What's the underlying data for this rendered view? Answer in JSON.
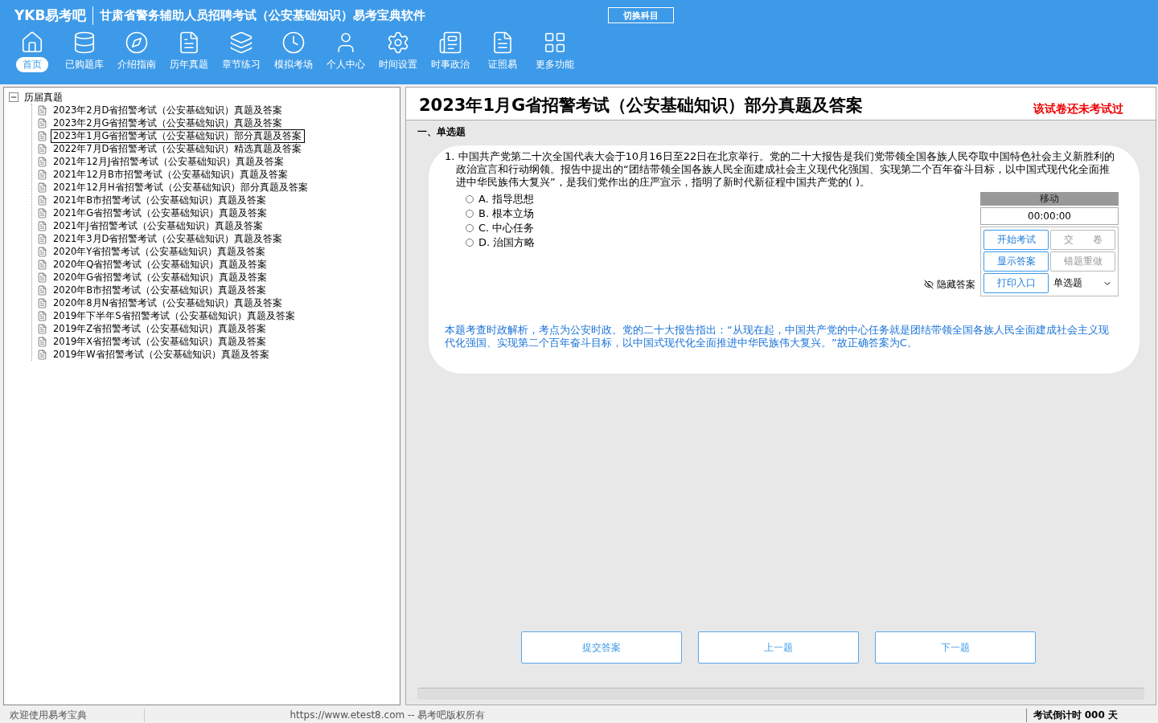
{
  "header": {
    "logo": "YKB易考吧",
    "title": "甘肃省警务辅助人员招聘考试（公安基础知识）易考宝典软件",
    "switch_button": "切换科目"
  },
  "toolbar": [
    {
      "label": "首页",
      "selected": true
    },
    {
      "label": "已购题库",
      "selected": false
    },
    {
      "label": "介绍指南",
      "selected": false
    },
    {
      "label": "历年真题",
      "selected": false
    },
    {
      "label": "章节练习",
      "selected": false
    },
    {
      "label": "模拟考场",
      "selected": false
    },
    {
      "label": "个人中心",
      "selected": false
    },
    {
      "label": "时间设置",
      "selected": false
    },
    {
      "label": "时事政治",
      "selected": false
    },
    {
      "label": "证照易",
      "selected": false
    },
    {
      "label": "更多功能",
      "selected": false
    }
  ],
  "tree": {
    "label": "历届真题",
    "expanded": true,
    "children": [
      {
        "label": "2023年2月D省招警考试（公安基础知识）真题及答案",
        "selected": false
      },
      {
        "label": "2023年2月G省招警考试（公安基础知识）真题及答案",
        "selected": false
      },
      {
        "label": "2023年1月G省招警考试（公安基础知识）部分真题及答案",
        "selected": true
      },
      {
        "label": "2022年7月D省招警考试（公安基础知识）精选真题及答案",
        "selected": false
      },
      {
        "label": "2021年12月J省招警考试（公安基础知识）真题及答案",
        "selected": false
      },
      {
        "label": "2021年12月B市招警考试（公安基础知识）真题及答案",
        "selected": false
      },
      {
        "label": "2021年12月H省招警考试（公安基础知识）部分真题及答案",
        "selected": false
      },
      {
        "label": "2021年B市招警考试（公安基础知识）真题及答案",
        "selected": false
      },
      {
        "label": "2021年G省招警考试（公安基础知识）真题及答案",
        "selected": false
      },
      {
        "label": "2021年J省招警考试（公安基础知识）真题及答案",
        "selected": false
      },
      {
        "label": "2021年3月D省招警考试（公安基础知识）真题及答案",
        "selected": false
      },
      {
        "label": "2020年Y省招警考试（公安基础知识）真题及答案",
        "selected": false
      },
      {
        "label": "2020年Q省招警考试（公安基础知识）真题及答案",
        "selected": false
      },
      {
        "label": "2020年G省招警考试（公安基础知识）真题及答案",
        "selected": false
      },
      {
        "label": "2020年B市招警考试（公安基础知识）真题及答案",
        "selected": false
      },
      {
        "label": "2020年8月N省招警考试（公安基础知识）真题及答案",
        "selected": false
      },
      {
        "label": "2019年下半年S省招警考试（公安基础知识）真题及答案",
        "selected": false
      },
      {
        "label": "2019年Z省招警考试（公安基础知识）真题及答案",
        "selected": false
      },
      {
        "label": "2019年X省招警考试（公安基础知识）真题及答案",
        "selected": false
      },
      {
        "label": "2019年W省招警考试（公安基础知识）真题及答案",
        "selected": false
      }
    ]
  },
  "exam": {
    "title": "2023年1月G省招警考试（公安基础知识）部分真题及答案",
    "status": "该试卷还未考试过",
    "section": "一、单选题",
    "question": {
      "number": "1.",
      "text": "中国共产党第二十次全国代表大会于10月16日至22日在北京举行。党的二十大报告是我们党带领全国各族人民夺取中国特色社会主义新胜利的政治宣言和行动纲领。报告中提出的“团结带领全国各族人民全面建成社会主义现代化强国、实现第二个百年奋斗目标，以中国式现代化全面推进中华民族伟大复兴”，是我们党作出的庄严宣示，指明了新时代新征程中国共产党的( )。",
      "options": [
        {
          "label": "A. 指导思想",
          "selected": false
        },
        {
          "label": "B. 根本立场",
          "selected": false
        },
        {
          "label": "C. 中心任务",
          "selected": false
        },
        {
          "label": "D. 治国方略",
          "selected": false
        }
      ],
      "analysis": "本题考查时政解析，考点为公安时政。党的二十大报告指出：“从现在起，中国共产党的中心任务就是团结带领全国各族人民全面建成社会主义现代化强国、实现第二个百年奋斗目标，以中国式现代化全面推进中华民族伟大复兴。”故正确答案为C。"
    },
    "control": {
      "move": "移动",
      "timer": "00:00:00",
      "hide_answer": "隐藏答案",
      "buttons": [
        {
          "label": "开始考试",
          "disabled": false
        },
        {
          "label": "交　　卷",
          "disabled": true
        },
        {
          "label": "显示答案",
          "disabled": false
        },
        {
          "label": "错题重做",
          "disabled": true
        },
        {
          "label": "打印入口",
          "disabled": false
        }
      ],
      "type_select": "单选题"
    },
    "nav_buttons": [
      "提交答案",
      "上一题",
      "下一题"
    ]
  },
  "status_bar": {
    "welcome": "欢迎使用易考宝典",
    "copyright": "https://www.etest8.com -- 易考吧版权所有",
    "countdown": "考试倒计时 000 天"
  }
}
